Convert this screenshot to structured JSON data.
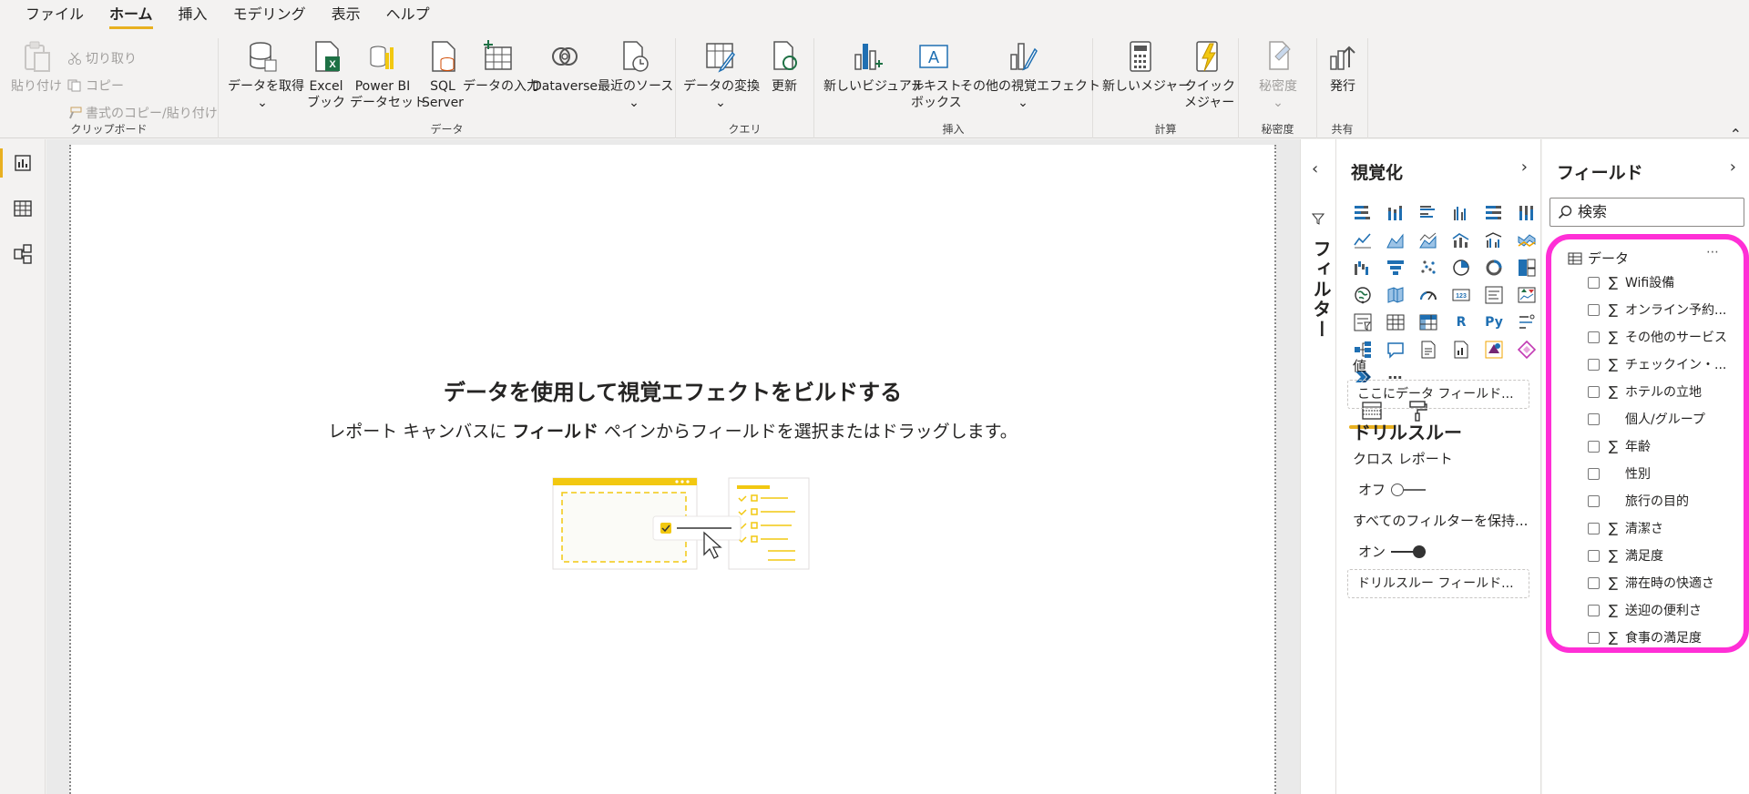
{
  "menu": {
    "tabs": [
      "ファイル",
      "ホーム",
      "挿入",
      "モデリング",
      "表示",
      "ヘルプ"
    ],
    "active": "ホーム"
  },
  "ribbon": {
    "clipboard": {
      "group_label": "クリップボード",
      "paste": "貼り付け",
      "cut": "切り取り",
      "copy": "コピー",
      "format_painter": "書式のコピー/貼り付け"
    },
    "data": {
      "group_label": "データ",
      "get_data": "データを取得",
      "excel_l1": "Excel",
      "excel_l2": "ブック",
      "pbi_l1": "Power BI",
      "pbi_l2": "データセット",
      "sql_l1": "SQL",
      "sql_l2": "Server",
      "enter_data": "データの入力",
      "dataverse": "Dataverse",
      "recent_sources": "最近のソース"
    },
    "query": {
      "group_label": "クエリ",
      "transform": "データの変換",
      "refresh": "更新"
    },
    "insert": {
      "group_label": "挿入",
      "new_visual": "新しいビジュアル",
      "textbox_l1": "テキスト",
      "textbox_l2": "ボックス",
      "more_visuals": "その他の視覚エフェクト"
    },
    "calc": {
      "group_label": "計算",
      "new_measure": "新しいメジャー",
      "quick_l1": "クイック",
      "quick_l2": "メジャー"
    },
    "sensitivity": {
      "group_label": "秘密度",
      "label": "秘密度"
    },
    "share": {
      "group_label": "共有",
      "publish": "発行"
    }
  },
  "canvas": {
    "title": "データを使用して視覚エフェクトをビルドする",
    "sub_prefix": "レポート キャンバスに ",
    "sub_bold": "フィールド",
    "sub_suffix": " ペインからフィールドを選択またはドラッグします。"
  },
  "filters": {
    "label": "フィルター"
  },
  "visualizations": {
    "title": "視覚化",
    "values_label": "値",
    "values_well": "ここにデータ フィールド...",
    "drillthrough_title": "ドリルスルー",
    "cross_report": "クロス レポート",
    "cross_report_state": "オフ",
    "keep_filters": "すべてのフィルターを保持...",
    "keep_filters_state": "オン",
    "drill_well": "ドリルスルー フィールド...",
    "more": "⋯"
  },
  "fields": {
    "title": "フィールド",
    "search_placeholder": "検索",
    "table_name": "データ",
    "table_more": "⋯",
    "items": [
      {
        "name": "Wifi設備",
        "sigma": "∑"
      },
      {
        "name": "オンライン予約...",
        "sigma": "∑"
      },
      {
        "name": "その他のサービス",
        "sigma": "∑"
      },
      {
        "name": "チェックイン・...",
        "sigma": "∑"
      },
      {
        "name": "ホテルの立地",
        "sigma": "∑"
      },
      {
        "name": "個人/グループ",
        "sigma": ""
      },
      {
        "name": "年齢",
        "sigma": "∑"
      },
      {
        "name": "性別",
        "sigma": ""
      },
      {
        "name": "旅行の目的",
        "sigma": ""
      },
      {
        "name": "清潔さ",
        "sigma": "∑"
      },
      {
        "name": "満足度",
        "sigma": "∑"
      },
      {
        "name": "滞在時の快適さ",
        "sigma": "∑"
      },
      {
        "name": "送迎の便利さ",
        "sigma": "∑"
      },
      {
        "name": "食事の満足度",
        "sigma": "∑"
      }
    ]
  },
  "colors": {
    "accent": "#e8b020",
    "highlight": "#ff2fd6",
    "icon_blue": "#1f6fb2"
  }
}
